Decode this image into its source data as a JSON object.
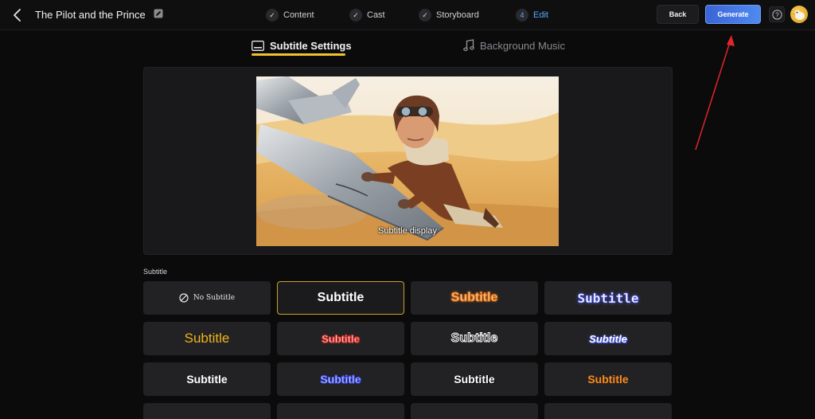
{
  "header": {
    "project_title": "The Pilot and the Prince",
    "steps": [
      {
        "label": "Content",
        "badge": "✓"
      },
      {
        "label": "Cast",
        "badge": "✓"
      },
      {
        "label": "Storyboard",
        "badge": "✓"
      },
      {
        "label": "Edit",
        "badge": "4"
      }
    ],
    "back_label": "Back",
    "generate_label": "Generate",
    "help_symbol": "?"
  },
  "tabs": {
    "subtitle_settings": "Subtitle Settings",
    "background_music": "Background Music"
  },
  "preview": {
    "subtitle_text": "Subtitle display"
  },
  "subtitle_section": {
    "label": "Subtitle",
    "options": [
      {
        "label": "No Subtitle"
      },
      {
        "label": "Subtitle"
      },
      {
        "label": "Subtitle"
      },
      {
        "label": "Subtitle"
      },
      {
        "label": "Subtitle"
      },
      {
        "label": "Subtitle"
      },
      {
        "label": "Subtitle"
      },
      {
        "label": "Subtitle"
      },
      {
        "label": "Subtitle"
      },
      {
        "label": "Subtitle"
      },
      {
        "label": "Subtitle"
      },
      {
        "label": "Subtitle"
      }
    ]
  },
  "colors": {
    "accent_active": "#59a7ff",
    "tab_underline": "#f2c12e",
    "generate_button": "#4f8af0",
    "selected_border": "#c9a227"
  }
}
